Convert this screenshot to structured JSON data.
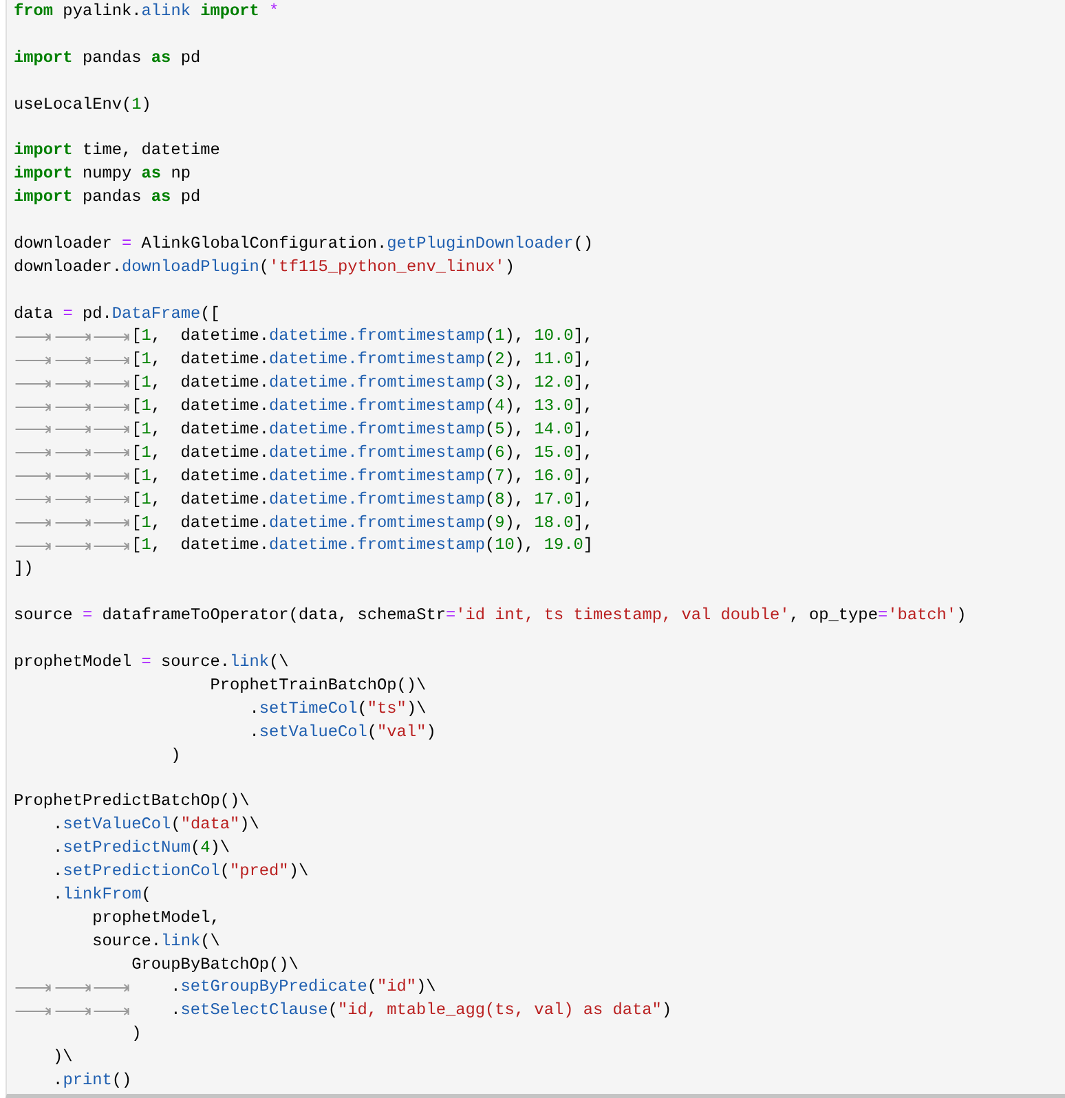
{
  "code_lines": [
    {
      "kind": "code",
      "tokens": [
        {
          "kind": "keyword",
          "text": "from"
        },
        {
          "kind": "name",
          "text": " pyalink."
        },
        {
          "kind": "attribute",
          "text": "alink"
        },
        {
          "kind": "keyword",
          "text": " import"
        },
        {
          "kind": "operator",
          "text": " *"
        }
      ]
    },
    {
      "kind": "blank"
    },
    {
      "kind": "code",
      "tokens": [
        {
          "kind": "keyword",
          "text": "import"
        },
        {
          "kind": "name",
          "text": " pandas "
        },
        {
          "kind": "keyword",
          "text": "as"
        },
        {
          "kind": "name",
          "text": " pd"
        }
      ]
    },
    {
      "kind": "blank"
    },
    {
      "kind": "code",
      "tokens": [
        {
          "kind": "name",
          "text": "useLocalEnv("
        },
        {
          "kind": "number",
          "text": "1"
        },
        {
          "kind": "name",
          "text": ")"
        }
      ]
    },
    {
      "kind": "blank"
    },
    {
      "kind": "code",
      "tokens": [
        {
          "kind": "keyword",
          "text": "import"
        },
        {
          "kind": "name",
          "text": " time, datetime"
        }
      ]
    },
    {
      "kind": "code",
      "tokens": [
        {
          "kind": "keyword",
          "text": "import"
        },
        {
          "kind": "name",
          "text": " numpy "
        },
        {
          "kind": "keyword",
          "text": "as"
        },
        {
          "kind": "name",
          "text": " np"
        }
      ]
    },
    {
      "kind": "code",
      "tokens": [
        {
          "kind": "keyword",
          "text": "import"
        },
        {
          "kind": "name",
          "text": " pandas "
        },
        {
          "kind": "keyword",
          "text": "as"
        },
        {
          "kind": "name",
          "text": " pd"
        }
      ]
    },
    {
      "kind": "blank"
    },
    {
      "kind": "code",
      "tokens": [
        {
          "kind": "name",
          "text": "downloader "
        },
        {
          "kind": "operator",
          "text": "="
        },
        {
          "kind": "name",
          "text": " AlinkGlobalConfiguration."
        },
        {
          "kind": "attribute",
          "text": "getPluginDownloader"
        },
        {
          "kind": "name",
          "text": "()"
        }
      ]
    },
    {
      "kind": "code",
      "tokens": [
        {
          "kind": "name",
          "text": "downloader."
        },
        {
          "kind": "attribute",
          "text": "downloadPlugin"
        },
        {
          "kind": "name",
          "text": "("
        },
        {
          "kind": "string",
          "text": "'tf115_python_env_linux'"
        },
        {
          "kind": "name",
          "text": ")"
        }
      ]
    },
    {
      "kind": "blank"
    },
    {
      "kind": "code",
      "tokens": [
        {
          "kind": "name",
          "text": "data "
        },
        {
          "kind": "operator",
          "text": "="
        },
        {
          "kind": "name",
          "text": " pd."
        },
        {
          "kind": "attribute",
          "text": "DataFrame"
        },
        {
          "kind": "name",
          "text": "(["
        }
      ]
    },
    {
      "kind": "code",
      "tokens": [
        {
          "kind": "tab"
        },
        {
          "kind": "tab"
        },
        {
          "kind": "tab"
        },
        {
          "kind": "name",
          "text": "["
        },
        {
          "kind": "number",
          "text": "1"
        },
        {
          "kind": "name",
          "text": ",  datetime."
        },
        {
          "kind": "attribute",
          "text": "datetime.fromtimestamp"
        },
        {
          "kind": "name",
          "text": "("
        },
        {
          "kind": "number",
          "text": "1"
        },
        {
          "kind": "name",
          "text": "), "
        },
        {
          "kind": "number",
          "text": "10.0"
        },
        {
          "kind": "name",
          "text": "],"
        }
      ]
    },
    {
      "kind": "code",
      "tokens": [
        {
          "kind": "tab"
        },
        {
          "kind": "tab"
        },
        {
          "kind": "tab"
        },
        {
          "kind": "name",
          "text": "["
        },
        {
          "kind": "number",
          "text": "1"
        },
        {
          "kind": "name",
          "text": ",  datetime."
        },
        {
          "kind": "attribute",
          "text": "datetime.fromtimestamp"
        },
        {
          "kind": "name",
          "text": "("
        },
        {
          "kind": "number",
          "text": "2"
        },
        {
          "kind": "name",
          "text": "), "
        },
        {
          "kind": "number",
          "text": "11.0"
        },
        {
          "kind": "name",
          "text": "],"
        }
      ]
    },
    {
      "kind": "code",
      "tokens": [
        {
          "kind": "tab"
        },
        {
          "kind": "tab"
        },
        {
          "kind": "tab"
        },
        {
          "kind": "name",
          "text": "["
        },
        {
          "kind": "number",
          "text": "1"
        },
        {
          "kind": "name",
          "text": ",  datetime."
        },
        {
          "kind": "attribute",
          "text": "datetime.fromtimestamp"
        },
        {
          "kind": "name",
          "text": "("
        },
        {
          "kind": "number",
          "text": "3"
        },
        {
          "kind": "name",
          "text": "), "
        },
        {
          "kind": "number",
          "text": "12.0"
        },
        {
          "kind": "name",
          "text": "],"
        }
      ]
    },
    {
      "kind": "code",
      "tokens": [
        {
          "kind": "tab"
        },
        {
          "kind": "tab"
        },
        {
          "kind": "tab"
        },
        {
          "kind": "name",
          "text": "["
        },
        {
          "kind": "number",
          "text": "1"
        },
        {
          "kind": "name",
          "text": ",  datetime."
        },
        {
          "kind": "attribute",
          "text": "datetime.fromtimestamp"
        },
        {
          "kind": "name",
          "text": "("
        },
        {
          "kind": "number",
          "text": "4"
        },
        {
          "kind": "name",
          "text": "), "
        },
        {
          "kind": "number",
          "text": "13.0"
        },
        {
          "kind": "name",
          "text": "],"
        }
      ]
    },
    {
      "kind": "code",
      "tokens": [
        {
          "kind": "tab"
        },
        {
          "kind": "tab"
        },
        {
          "kind": "tab"
        },
        {
          "kind": "name",
          "text": "["
        },
        {
          "kind": "number",
          "text": "1"
        },
        {
          "kind": "name",
          "text": ",  datetime."
        },
        {
          "kind": "attribute",
          "text": "datetime.fromtimestamp"
        },
        {
          "kind": "name",
          "text": "("
        },
        {
          "kind": "number",
          "text": "5"
        },
        {
          "kind": "name",
          "text": "), "
        },
        {
          "kind": "number",
          "text": "14.0"
        },
        {
          "kind": "name",
          "text": "],"
        }
      ]
    },
    {
      "kind": "code",
      "tokens": [
        {
          "kind": "tab"
        },
        {
          "kind": "tab"
        },
        {
          "kind": "tab"
        },
        {
          "kind": "name",
          "text": "["
        },
        {
          "kind": "number",
          "text": "1"
        },
        {
          "kind": "name",
          "text": ",  datetime."
        },
        {
          "kind": "attribute",
          "text": "datetime.fromtimestamp"
        },
        {
          "kind": "name",
          "text": "("
        },
        {
          "kind": "number",
          "text": "6"
        },
        {
          "kind": "name",
          "text": "), "
        },
        {
          "kind": "number",
          "text": "15.0"
        },
        {
          "kind": "name",
          "text": "],"
        }
      ]
    },
    {
      "kind": "code",
      "tokens": [
        {
          "kind": "tab"
        },
        {
          "kind": "tab"
        },
        {
          "kind": "tab"
        },
        {
          "kind": "name",
          "text": "["
        },
        {
          "kind": "number",
          "text": "1"
        },
        {
          "kind": "name",
          "text": ",  datetime."
        },
        {
          "kind": "attribute",
          "text": "datetime.fromtimestamp"
        },
        {
          "kind": "name",
          "text": "("
        },
        {
          "kind": "number",
          "text": "7"
        },
        {
          "kind": "name",
          "text": "), "
        },
        {
          "kind": "number",
          "text": "16.0"
        },
        {
          "kind": "name",
          "text": "],"
        }
      ]
    },
    {
      "kind": "code",
      "tokens": [
        {
          "kind": "tab"
        },
        {
          "kind": "tab"
        },
        {
          "kind": "tab"
        },
        {
          "kind": "name",
          "text": "["
        },
        {
          "kind": "number",
          "text": "1"
        },
        {
          "kind": "name",
          "text": ",  datetime."
        },
        {
          "kind": "attribute",
          "text": "datetime.fromtimestamp"
        },
        {
          "kind": "name",
          "text": "("
        },
        {
          "kind": "number",
          "text": "8"
        },
        {
          "kind": "name",
          "text": "), "
        },
        {
          "kind": "number",
          "text": "17.0"
        },
        {
          "kind": "name",
          "text": "],"
        }
      ]
    },
    {
      "kind": "code",
      "tokens": [
        {
          "kind": "tab"
        },
        {
          "kind": "tab"
        },
        {
          "kind": "tab"
        },
        {
          "kind": "name",
          "text": "["
        },
        {
          "kind": "number",
          "text": "1"
        },
        {
          "kind": "name",
          "text": ",  datetime."
        },
        {
          "kind": "attribute",
          "text": "datetime.fromtimestamp"
        },
        {
          "kind": "name",
          "text": "("
        },
        {
          "kind": "number",
          "text": "9"
        },
        {
          "kind": "name",
          "text": "), "
        },
        {
          "kind": "number",
          "text": "18.0"
        },
        {
          "kind": "name",
          "text": "],"
        }
      ]
    },
    {
      "kind": "code",
      "tokens": [
        {
          "kind": "tab"
        },
        {
          "kind": "tab"
        },
        {
          "kind": "tab"
        },
        {
          "kind": "name",
          "text": "["
        },
        {
          "kind": "number",
          "text": "1"
        },
        {
          "kind": "name",
          "text": ",  datetime."
        },
        {
          "kind": "attribute",
          "text": "datetime.fromtimestamp"
        },
        {
          "kind": "name",
          "text": "("
        },
        {
          "kind": "number",
          "text": "10"
        },
        {
          "kind": "name",
          "text": "), "
        },
        {
          "kind": "number",
          "text": "19.0"
        },
        {
          "kind": "name",
          "text": "]"
        }
      ]
    },
    {
      "kind": "code",
      "tokens": [
        {
          "kind": "name",
          "text": "])"
        }
      ]
    },
    {
      "kind": "blank"
    },
    {
      "kind": "code",
      "tokens": [
        {
          "kind": "name",
          "text": "source "
        },
        {
          "kind": "operator",
          "text": "="
        },
        {
          "kind": "name",
          "text": " dataframeToOperator(data, schemaStr"
        },
        {
          "kind": "operator",
          "text": "="
        },
        {
          "kind": "string",
          "text": "'id int, ts timestamp, val double'"
        },
        {
          "kind": "name",
          "text": ", op_type"
        },
        {
          "kind": "operator",
          "text": "="
        },
        {
          "kind": "string",
          "text": "'batch'"
        },
        {
          "kind": "name",
          "text": ")"
        }
      ]
    },
    {
      "kind": "blank"
    },
    {
      "kind": "code",
      "tokens": [
        {
          "kind": "name",
          "text": "prophetModel "
        },
        {
          "kind": "operator",
          "text": "="
        },
        {
          "kind": "name",
          "text": " source."
        },
        {
          "kind": "attribute",
          "text": "link"
        },
        {
          "kind": "name",
          "text": "(\\"
        }
      ]
    },
    {
      "kind": "code",
      "tokens": [
        {
          "kind": "name",
          "text": "                    ProphetTrainBatchOp()\\"
        }
      ]
    },
    {
      "kind": "code",
      "tokens": [
        {
          "kind": "name",
          "text": "                        ."
        },
        {
          "kind": "attribute",
          "text": "setTimeCol"
        },
        {
          "kind": "name",
          "text": "("
        },
        {
          "kind": "string",
          "text": "\"ts\""
        },
        {
          "kind": "name",
          "text": ")\\"
        }
      ]
    },
    {
      "kind": "code",
      "tokens": [
        {
          "kind": "name",
          "text": "                        ."
        },
        {
          "kind": "attribute",
          "text": "setValueCol"
        },
        {
          "kind": "name",
          "text": "("
        },
        {
          "kind": "string",
          "text": "\"val\""
        },
        {
          "kind": "name",
          "text": ")"
        }
      ]
    },
    {
      "kind": "code",
      "tokens": [
        {
          "kind": "name",
          "text": "                )"
        }
      ]
    },
    {
      "kind": "blank"
    },
    {
      "kind": "code",
      "tokens": [
        {
          "kind": "name",
          "text": "ProphetPredictBatchOp()\\"
        }
      ]
    },
    {
      "kind": "code",
      "tokens": [
        {
          "kind": "name",
          "text": "    ."
        },
        {
          "kind": "attribute",
          "text": "setValueCol"
        },
        {
          "kind": "name",
          "text": "("
        },
        {
          "kind": "string",
          "text": "\"data\""
        },
        {
          "kind": "name",
          "text": ")\\"
        }
      ]
    },
    {
      "kind": "code",
      "tokens": [
        {
          "kind": "name",
          "text": "    ."
        },
        {
          "kind": "attribute",
          "text": "setPredictNum"
        },
        {
          "kind": "name",
          "text": "("
        },
        {
          "kind": "number",
          "text": "4"
        },
        {
          "kind": "name",
          "text": ")\\"
        }
      ]
    },
    {
      "kind": "code",
      "tokens": [
        {
          "kind": "name",
          "text": "    ."
        },
        {
          "kind": "attribute",
          "text": "setPredictionCol"
        },
        {
          "kind": "name",
          "text": "("
        },
        {
          "kind": "string",
          "text": "\"pred\""
        },
        {
          "kind": "name",
          "text": ")\\"
        }
      ]
    },
    {
      "kind": "code",
      "tokens": [
        {
          "kind": "name",
          "text": "    ."
        },
        {
          "kind": "attribute",
          "text": "linkFrom"
        },
        {
          "kind": "name",
          "text": "("
        }
      ]
    },
    {
      "kind": "code",
      "tokens": [
        {
          "kind": "name",
          "text": "        prophetModel,"
        }
      ]
    },
    {
      "kind": "code",
      "tokens": [
        {
          "kind": "name",
          "text": "        source."
        },
        {
          "kind": "attribute",
          "text": "link"
        },
        {
          "kind": "name",
          "text": "(\\"
        }
      ]
    },
    {
      "kind": "code",
      "tokens": [
        {
          "kind": "name",
          "text": "            GroupByBatchOp()\\"
        }
      ]
    },
    {
      "kind": "code",
      "tokens": [
        {
          "kind": "tab"
        },
        {
          "kind": "tab"
        },
        {
          "kind": "tab"
        },
        {
          "kind": "name",
          "text": "    ."
        },
        {
          "kind": "attribute",
          "text": "setGroupByPredicate"
        },
        {
          "kind": "name",
          "text": "("
        },
        {
          "kind": "string",
          "text": "\"id\""
        },
        {
          "kind": "name",
          "text": ")\\"
        }
      ]
    },
    {
      "kind": "code",
      "tokens": [
        {
          "kind": "tab"
        },
        {
          "kind": "tab"
        },
        {
          "kind": "tab"
        },
        {
          "kind": "name",
          "text": "    ."
        },
        {
          "kind": "attribute",
          "text": "setSelectClause"
        },
        {
          "kind": "name",
          "text": "("
        },
        {
          "kind": "string",
          "text": "\"id, mtable_agg(ts, val) as data\""
        },
        {
          "kind": "name",
          "text": ")"
        }
      ]
    },
    {
      "kind": "code",
      "tokens": [
        {
          "kind": "name",
          "text": "            )"
        }
      ]
    },
    {
      "kind": "code",
      "tokens": [
        {
          "kind": "name",
          "text": "    )\\"
        }
      ]
    },
    {
      "kind": "code",
      "tokens": [
        {
          "kind": "name",
          "text": "    ."
        },
        {
          "kind": "attribute",
          "text": "print"
        },
        {
          "kind": "name",
          "text": "()"
        }
      ]
    }
  ]
}
